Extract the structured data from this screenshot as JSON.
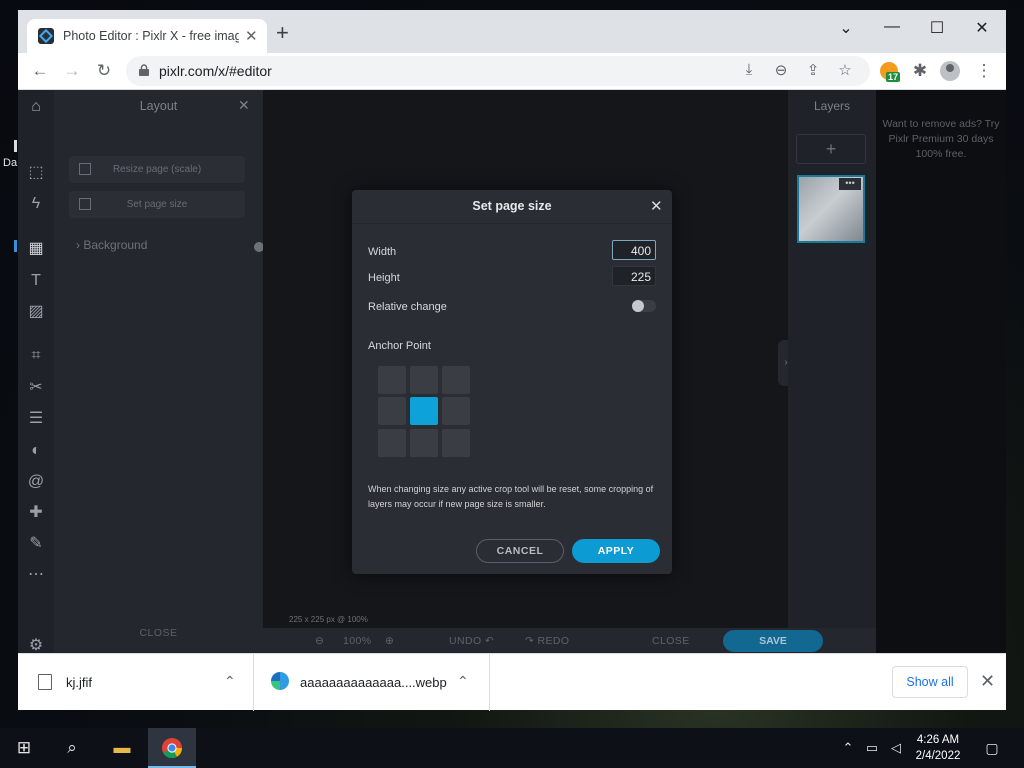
{
  "desktop": {
    "label": "Da"
  },
  "browser": {
    "tab_title": "Photo Editor : Pixlr X - free image",
    "new_tab": "+",
    "url": "pixlr.com/x/#editor",
    "extension_badge": "17"
  },
  "layout_panel": {
    "title": "Layout",
    "resize_label": "Resize page (scale)",
    "set_page_label": "Set page size",
    "background_label": "Background",
    "close_label": "CLOSE"
  },
  "canvas": {
    "info": "225 x 225 px @ 100%"
  },
  "bottombar": {
    "zoom": "100%",
    "undo": "UNDO",
    "redo": "REDO",
    "close": "CLOSE",
    "save": "SAVE"
  },
  "layers_panel": {
    "title": "Layers",
    "add": "+"
  },
  "ad": {
    "text": "Want to remove ads? Try Pixlr Premium 30 days 100% free."
  },
  "modal": {
    "title": "Set page size",
    "width_label": "Width",
    "width_value": "400",
    "height_label": "Height",
    "height_value": "225",
    "relative_label": "Relative change",
    "relative_on": false,
    "anchor_label": "Anchor Point",
    "anchor_selected": "center",
    "note": "When changing size any active crop tool will be reset, some cropping of layers may occur if new page size is smaller.",
    "cancel_label": "CANCEL",
    "apply_label": "APPLY"
  },
  "downloads": {
    "items": [
      {
        "name": "kj.jfif"
      },
      {
        "name": "aaaaaaaaaaaaaa....webp"
      }
    ],
    "show_all": "Show all"
  },
  "taskbar": {
    "time": "4:26 AM",
    "date": "2/4/2022"
  },
  "colors": {
    "accent": "#0c9bd3",
    "save_button": "#126891",
    "panel_bg": "#24272d",
    "modal_bg": "#2a2d33"
  }
}
